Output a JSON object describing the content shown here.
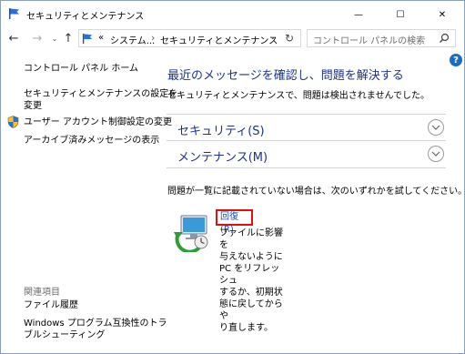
{
  "window": {
    "title": "セキュリティとメンテナンス",
    "minimize_glyph": "—",
    "maximize_glyph": "☐",
    "close_glyph": "✕"
  },
  "navigation": {
    "back_glyph": "←",
    "forward_glyph": "→",
    "recent_glyph": "⌄",
    "up_glyph": "↑",
    "address_segments": [
      "«",
      "システム...",
      "›",
      "セキュリティとメンテナンス"
    ],
    "dropdown_glyph": "⌄",
    "refresh_glyph": "↻",
    "search_placeholder": "コントロール パネルの検索"
  },
  "help": {
    "label": "?"
  },
  "sidebar": {
    "items": [
      {
        "label": "コントロール パネル ホーム"
      },
      {
        "label_line1": "セキュリティとメンテナンスの設定を",
        "label_line2": "変更"
      },
      {
        "label": "ユーザー アカウント制御設定の変更"
      },
      {
        "label": "アーカイブ済みメッセージの表示"
      }
    ],
    "section_header": "関連項目",
    "related": [
      {
        "label": "ファイル履歴"
      },
      {
        "label_line1": "Windows プログラム互換性のトラ",
        "label_line2": "ブルシューティング"
      }
    ]
  },
  "main": {
    "title": "最近のメッセージを確認し、問題を解決する",
    "subtitle": "セキュリティとメンテナンスで、問題は検出されませんでした。",
    "sections": [
      {
        "label": "セキュリティ(S)"
      },
      {
        "label": "メンテナンス(M)"
      }
    ],
    "problem_text": "問題が一覧に記載されていない場合は、次のいずれかを試してください。",
    "recovery": {
      "link_label": "回復(R)",
      "description_lines": [
        "ファイルに影響を",
        "与えないように",
        "PC をリフレッシュ",
        "するか、初期状",
        "態に戻してからや",
        "り直します。"
      ]
    }
  },
  "colors": {
    "link_blue": "#1e3287",
    "highlight_red": "#e01010",
    "help_blue": "#1a6fc2"
  }
}
